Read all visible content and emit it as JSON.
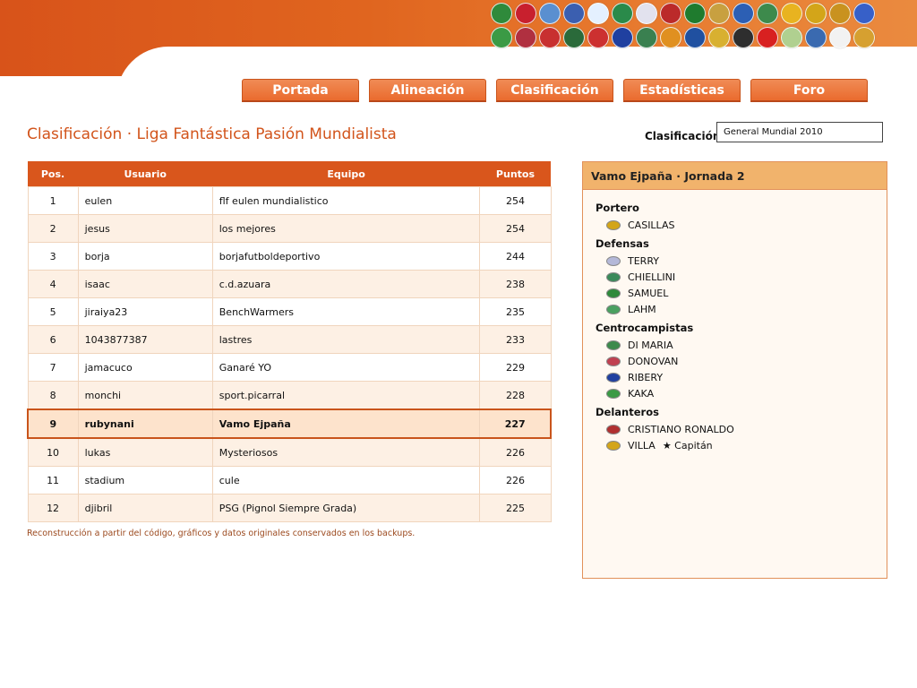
{
  "colors": {
    "brand_orange": "#d9561c",
    "nav_button": "#ea6b2e",
    "panel_header": "#f1b36c",
    "row_alt": "#fdf0e4",
    "highlight_row": "#fde3cc"
  },
  "header": {
    "flag_icons_row1": [
      "germany-badge",
      "denmark-badge",
      "argentina-badge",
      "greece-badge",
      "slovenia-badge",
      "algeria-badge",
      "england-badge",
      "korea-badge",
      "nigeria-badge",
      "paraguay-badge",
      "italy-badge",
      "mexico-badge",
      "south-africa-badge",
      "spain-badge",
      "portugal-badge",
      "slovakia-badge"
    ],
    "flag_icons_row2": [
      "brazil-badge",
      "usa-badge",
      "mexico-badge",
      "serbia-badge",
      "cameroon-badge",
      "france-badge",
      "honduras-badge",
      "ivory-coast-badge",
      "ghana-badge",
      "japan-badge",
      "new-zealand-badge",
      "switzerland-badge",
      "chile-badge",
      "north-korea-badge",
      "uruguay-badge",
      "netherlands-badge"
    ],
    "flag_colors_row1": [
      "#2f8a3b",
      "#c8202e",
      "#5a8fd0",
      "#3b5fb0",
      "#e4f0ff",
      "#2a8a4a",
      "#e2e2ee",
      "#bb2a2a",
      "#1f7b2e",
      "#c8a040",
      "#2c5fb4",
      "#3d8a4c",
      "#e8b320",
      "#d3a519",
      "#c9921f",
      "#3760c8"
    ],
    "flag_colors_row2": [
      "#3b9a45",
      "#b03040",
      "#c83030",
      "#2a6a3a",
      "#cc3030",
      "#2040a0",
      "#3a8050",
      "#e09020",
      "#2050a0",
      "#d8b030",
      "#2e2e2e",
      "#d82020",
      "#b0d090",
      "#3a6ab0",
      "#f2f2f2",
      "#d6a030"
    ]
  },
  "nav": [
    {
      "label": "Portada"
    },
    {
      "label": "Alineación"
    },
    {
      "label": "Clasificación"
    },
    {
      "label": "Estadísticas"
    },
    {
      "label": "Foro"
    }
  ],
  "title": "Clasificación · Liga Fantástica Pasión Mundialista",
  "filter": {
    "label": "Clasificación:",
    "selected": "General Mundial 2010"
  },
  "table": {
    "headers": [
      "Pos.",
      "Usuario",
      "Equipo",
      "Puntos"
    ],
    "rows": [
      {
        "pos": "1",
        "user": "eulen",
        "team": "flf eulen mundialistico",
        "points": "254"
      },
      {
        "pos": "2",
        "user": "jesus",
        "team": "los mejores",
        "points": "254"
      },
      {
        "pos": "3",
        "user": "borja",
        "team": "borjafutboldeportivo",
        "points": "244"
      },
      {
        "pos": "4",
        "user": "isaac",
        "team": "c.d.azuara",
        "points": "238"
      },
      {
        "pos": "5",
        "user": "jiraiya23",
        "team": "BenchWarmers",
        "points": "235"
      },
      {
        "pos": "6",
        "user": "1043877387",
        "team": "lastres",
        "points": "233"
      },
      {
        "pos": "7",
        "user": "jamacuco",
        "team": "Ganaré YO",
        "points": "229"
      },
      {
        "pos": "8",
        "user": "monchi",
        "team": "sport.picarral",
        "points": "228"
      },
      {
        "pos": "9",
        "user": "rubynani",
        "team": "Vamo Ejpaña",
        "points": "227"
      },
      {
        "pos": "10",
        "user": "lukas",
        "team": "Mysteriosos",
        "points": "226"
      },
      {
        "pos": "11",
        "user": "stadium",
        "team": "cule",
        "points": "226"
      },
      {
        "pos": "12",
        "user": "djibril",
        "team": "PSG (Pignol Siempre Grada)",
        "points": "225"
      }
    ]
  },
  "footer_note": "Reconstrucción a partir del código, gráficos y datos originales conservados en los backups.",
  "panel": {
    "title": "Vamo Ejpaña · Jornada 2",
    "groups": [
      {
        "title": "Portero",
        "players": [
          {
            "name": "CASILLAS",
            "badge": "#d3a519"
          }
        ]
      },
      {
        "title": "Defensas",
        "players": [
          {
            "name": "TERRY",
            "badge": "#b4b8d8"
          },
          {
            "name": "CHIELLINI",
            "badge": "#3a8a5a"
          },
          {
            "name": "SAMUEL",
            "badge": "#2f8a3b"
          },
          {
            "name": "LAHM",
            "badge": "#4aa060"
          }
        ]
      },
      {
        "title": "Centrocampistas",
        "players": [
          {
            "name": "DI MARIA",
            "badge": "#3d8a4c"
          },
          {
            "name": "DONOVAN",
            "badge": "#c04050"
          },
          {
            "name": "RIBERY",
            "badge": "#2040a0"
          },
          {
            "name": "KAKA",
            "badge": "#3b9a45"
          }
        ]
      },
      {
        "title": "Delanteros",
        "players": [
          {
            "name": "CRISTIANO RONALDO",
            "badge": "#b03030"
          },
          {
            "name": "VILLA",
            "badge": "#d3a519",
            "captain": "★ Capitán"
          }
        ]
      }
    ]
  }
}
